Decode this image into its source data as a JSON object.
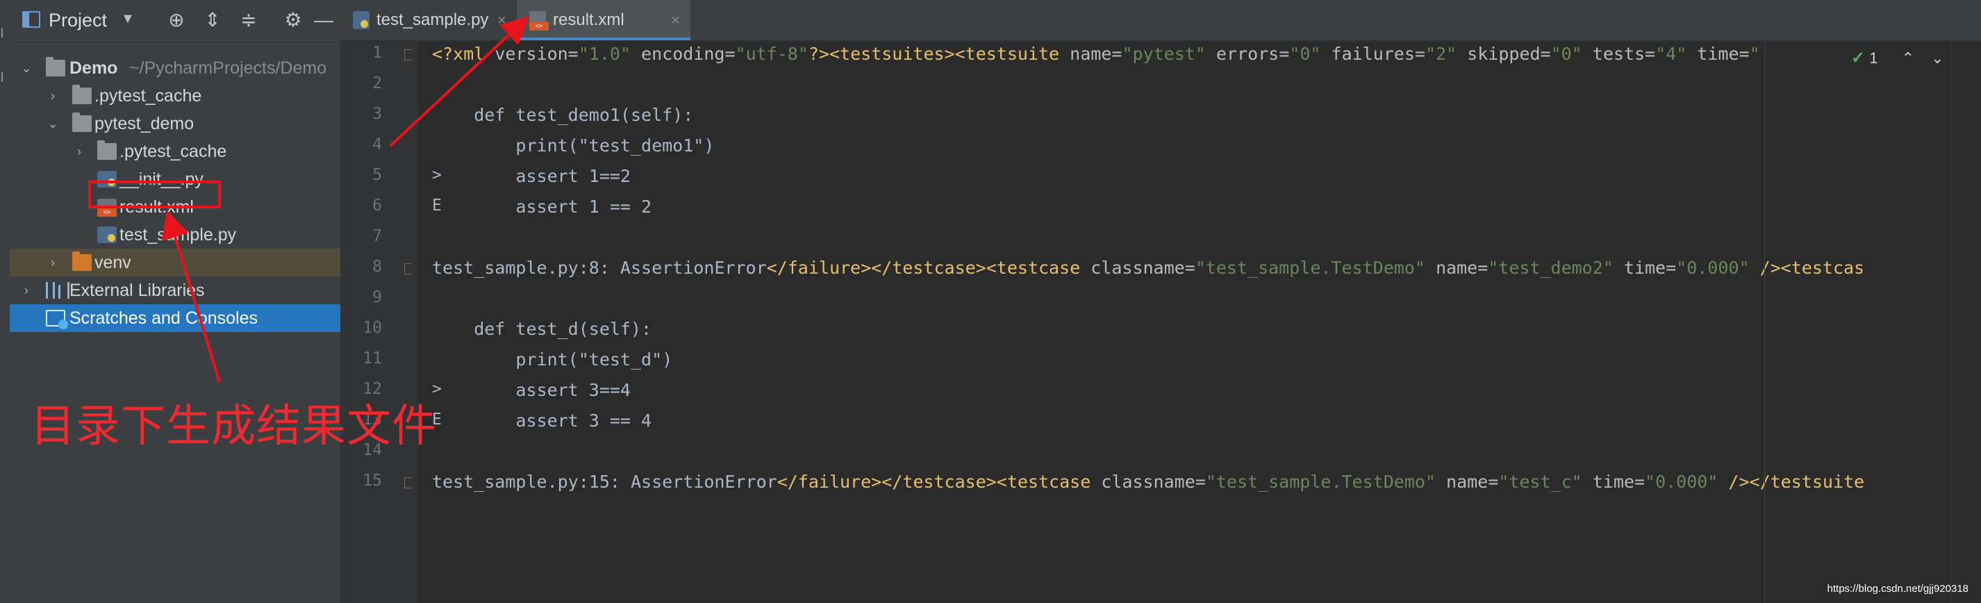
{
  "project_panel": {
    "title": "Project",
    "tree": [
      {
        "label": "Demo",
        "suffix": "~/PycharmProjects/Demo",
        "icon": "folder-icon",
        "expanded": true
      },
      {
        "label": ".pytest_cache",
        "icon": "folder-icon",
        "expanded": false
      },
      {
        "label": "pytest_demo",
        "icon": "folder-icon",
        "expanded": true
      },
      {
        "label": ".pytest_cache",
        "icon": "folder-icon",
        "expanded": false
      },
      {
        "label": "__init__.py",
        "icon": "python-file-icon"
      },
      {
        "label": "result.xml",
        "icon": "xml-file-icon"
      },
      {
        "label": "test_sample.py",
        "icon": "python-file-icon"
      },
      {
        "label": "venv",
        "icon": "folder-icon",
        "expanded": false
      },
      {
        "label": "External Libraries",
        "icon": "libraries-icon",
        "expanded": false
      },
      {
        "label": "Scratches and Consoles",
        "icon": "scratches-icon",
        "selected": true
      }
    ]
  },
  "tabs": [
    {
      "label": "test_sample.py",
      "icon": "python-file-icon",
      "active": false
    },
    {
      "label": "result.xml",
      "icon": "xml-file-icon",
      "active": true
    }
  ],
  "editor": {
    "inspection_count": "1",
    "lines": [
      {
        "n": "1",
        "marker": ""
      },
      {
        "n": "2",
        "marker": "",
        "text": ""
      },
      {
        "n": "3",
        "marker": "",
        "text": "    def test_demo1(self):"
      },
      {
        "n": "4",
        "marker": "",
        "text": "        print(\"test_demo1\")"
      },
      {
        "n": "5",
        "marker": ">",
        "text": "        assert 1==2"
      },
      {
        "n": "6",
        "marker": "E",
        "text": "        assert 1 == 2"
      },
      {
        "n": "7",
        "marker": "",
        "text": ""
      },
      {
        "n": "8",
        "marker": ""
      },
      {
        "n": "9",
        "marker": "",
        "text": ""
      },
      {
        "n": "10",
        "marker": "",
        "text": "    def test_d(self):"
      },
      {
        "n": "11",
        "marker": "",
        "text": "        print(\"test_d\")"
      },
      {
        "n": "12",
        "marker": ">",
        "text": "        assert 3==4"
      },
      {
        "n": "13",
        "marker": "E",
        "text": "        assert 3 == 4"
      },
      {
        "n": "14",
        "marker": "",
        "text": ""
      },
      {
        "n": "15",
        "marker": ""
      }
    ],
    "line1": {
      "decl": "<?xml",
      "decl_attrs": [
        {
          "name": " version=",
          "value": "\"1.0\""
        },
        {
          "name": " encoding=",
          "value": "\"utf-8\""
        }
      ],
      "decl_end": "?>",
      "tags": "<testsuites><testsuite",
      "attrs": [
        {
          "name": " name=",
          "value": "\"pytest\""
        },
        {
          "name": " errors=",
          "value": "\"0\""
        },
        {
          "name": " failures=",
          "value": "\"2\""
        },
        {
          "name": " skipped=",
          "value": "\"0\""
        },
        {
          "name": " tests=",
          "value": "\"4\""
        },
        {
          "name": " time=",
          "value": "\""
        }
      ]
    },
    "line8": {
      "text": "test_sample.py:8: AssertionError",
      "tags": "</failure></testcase><testcase",
      "attrs": [
        {
          "name": " classname=",
          "value": "\"test_sample.TestDemo\""
        },
        {
          "name": " name=",
          "value": "\"test_demo2\""
        },
        {
          "name": " time=",
          "value": "\"0.000\""
        }
      ],
      "tail": " /><testcas"
    },
    "line15": {
      "text": "test_sample.py:15: AssertionError",
      "tags": "</failure></testcase><testcase",
      "attrs": [
        {
          "name": " classname=",
          "value": "\"test_sample.TestDemo\""
        },
        {
          "name": " name=",
          "value": "\"test_c\""
        },
        {
          "name": " time=",
          "value": "\"0.000\""
        }
      ],
      "tail": " /></testsuite"
    }
  },
  "annotation": {
    "caption": "目录下生成结果文件",
    "color": "#e8141b"
  },
  "watermark": "https://blog.csdn.net/gjj920318"
}
